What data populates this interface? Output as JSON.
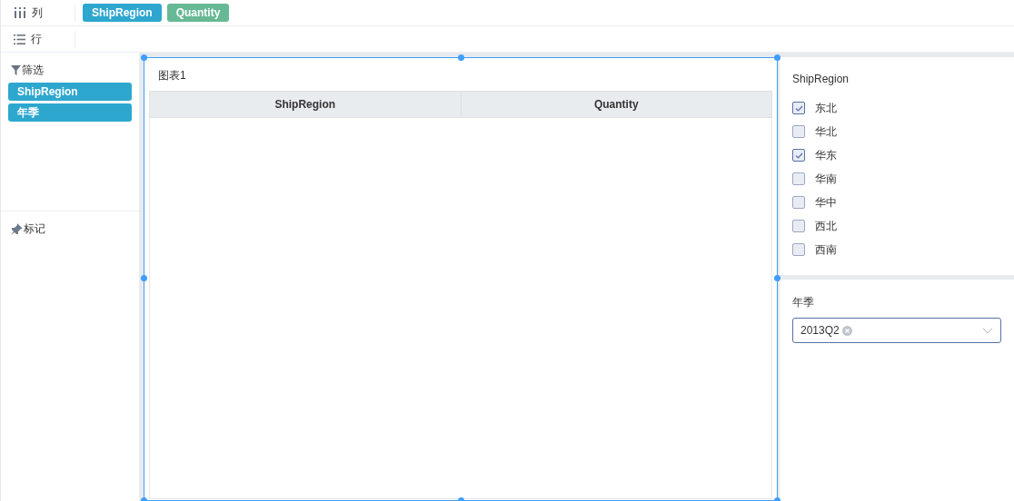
{
  "shelves": [
    {
      "kind": "columns",
      "label": "列",
      "pills": [
        {
          "text": "ShipRegion",
          "color": "#2ea7cf"
        },
        {
          "text": "Quantity",
          "color": "#67b995"
        }
      ]
    },
    {
      "kind": "rows",
      "label": "行"
    }
  ],
  "filters": {
    "title": "筛选",
    "pills": [
      "ShipRegion",
      "年季"
    ]
  },
  "marks": {
    "title": "标记"
  },
  "chart": {
    "title": "图表1",
    "columns": [
      "ShipRegion",
      "Quantity"
    ]
  },
  "region_filter": {
    "title": "ShipRegion",
    "options": [
      {
        "label": "东北",
        "checked": true
      },
      {
        "label": "华北",
        "checked": false
      },
      {
        "label": "华东",
        "checked": true
      },
      {
        "label": "华南",
        "checked": false
      },
      {
        "label": "华中",
        "checked": false
      },
      {
        "label": "西北",
        "checked": false
      },
      {
        "label": "西南",
        "checked": false
      }
    ]
  },
  "season_filter": {
    "title": "年季",
    "tags": [
      "2013Q2"
    ]
  }
}
